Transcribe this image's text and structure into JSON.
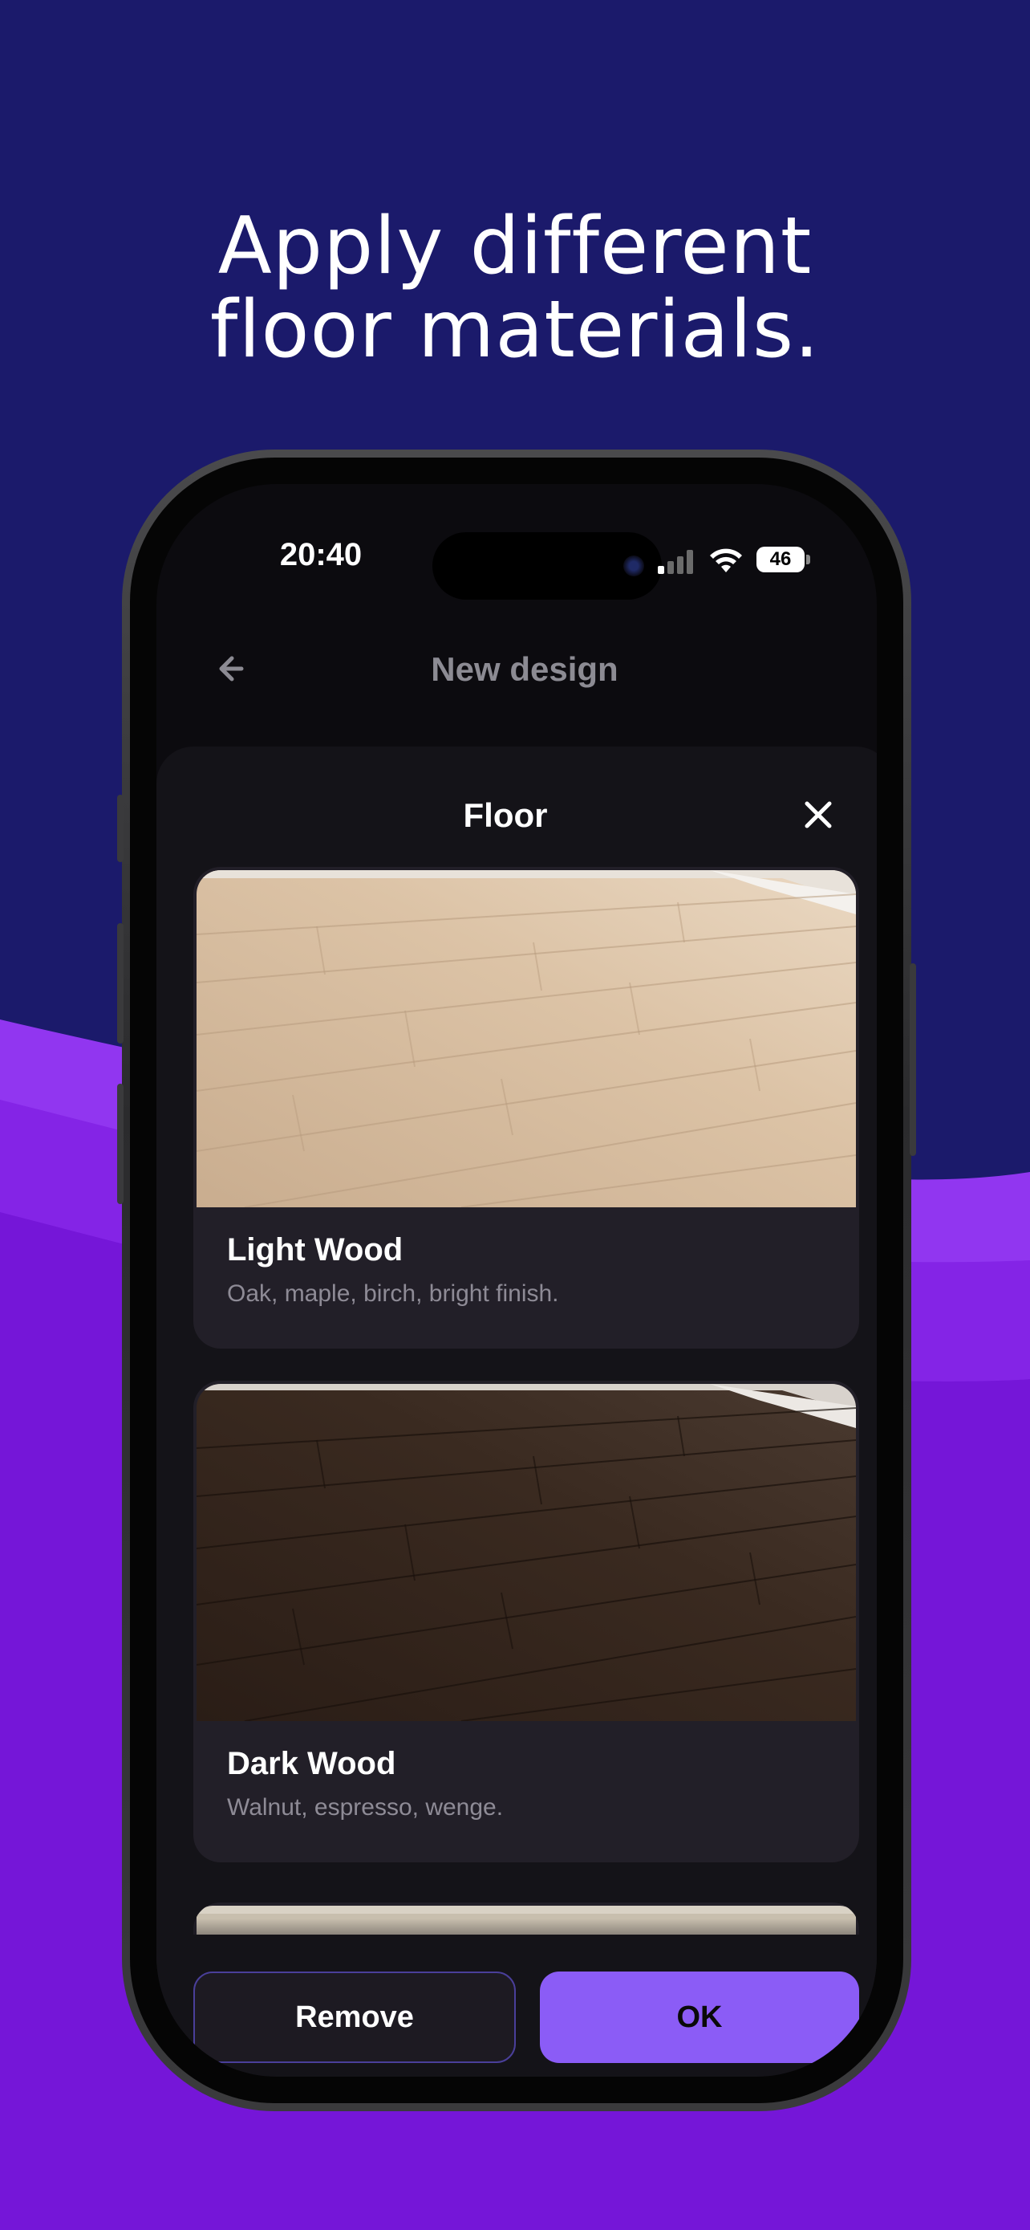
{
  "headline": {
    "line1": "Apply different",
    "line2": "floor materials."
  },
  "status_bar": {
    "time": "20:40",
    "battery": "46"
  },
  "nav": {
    "title": "New design"
  },
  "sheet": {
    "title": "Floor",
    "materials": [
      {
        "name": "Light Wood",
        "description": "Oak, maple, birch, bright finish."
      },
      {
        "name": "Dark Wood",
        "description": "Walnut, espresso, wenge."
      }
    ]
  },
  "actions": {
    "remove_label": "Remove",
    "ok_label": "OK"
  },
  "colors": {
    "background_top": "#1b1a6b",
    "background_bottom": "#7a1bd9",
    "accent": "#8b5cf6"
  },
  "icons": [
    "back-arrow-icon",
    "close-icon",
    "signal-icon",
    "wifi-icon",
    "battery-icon"
  ]
}
